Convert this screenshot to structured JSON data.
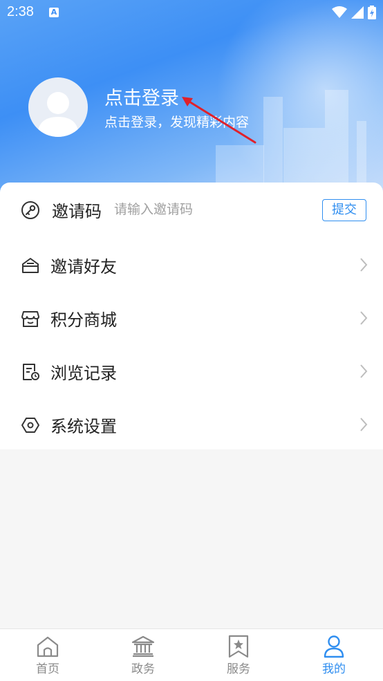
{
  "status_bar": {
    "time": "2:38",
    "notification_letter": "A"
  },
  "profile": {
    "title": "点击登录",
    "subtitle": "点击登录，发现精彩内容"
  },
  "invite": {
    "label": "邀请码",
    "placeholder": "请输入邀请码",
    "value": "",
    "submit_label": "提交"
  },
  "menu": [
    {
      "label": "邀请好友",
      "icon": "mail-open-icon"
    },
    {
      "label": "积分商城",
      "icon": "store-icon"
    },
    {
      "label": "浏览记录",
      "icon": "history-doc-icon"
    },
    {
      "label": "系统设置",
      "icon": "hexagon-settings-icon"
    }
  ],
  "nav": [
    {
      "label": "首页",
      "icon": "home-icon",
      "active": false
    },
    {
      "label": "政务",
      "icon": "government-building-icon",
      "active": false
    },
    {
      "label": "服务",
      "icon": "star-bookmark-icon",
      "active": false
    },
    {
      "label": "我的",
      "icon": "user-icon",
      "active": true
    }
  ],
  "colors": {
    "accent": "#2f8ef0",
    "header_blue": "#3d8ff5",
    "annotation_arrow": "#e0212b"
  }
}
